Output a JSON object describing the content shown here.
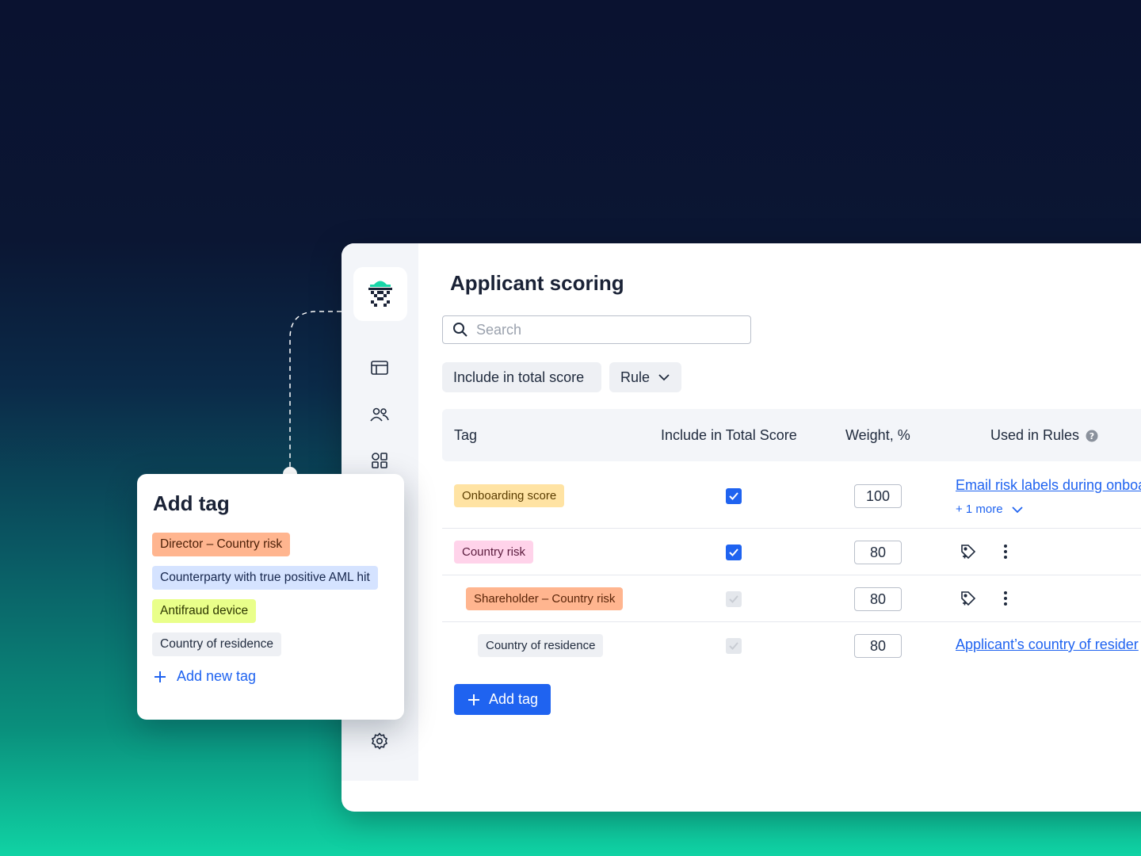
{
  "page": {
    "title": "Applicant scoring",
    "search_placeholder": "Search"
  },
  "filters": {
    "include_label": "Include in total score",
    "rule_label": "Rule"
  },
  "table": {
    "headers": [
      "Tag",
      "Include in Total Score",
      "Weight, %",
      "Used in Rules"
    ],
    "rows": [
      {
        "tag": "Onboarding score",
        "included": true,
        "weight": "100",
        "rule": "Email risk labels during onboa",
        "more": "+ 1 more"
      },
      {
        "tag": "Country risk",
        "included": true,
        "weight": "80"
      },
      {
        "tag": "Shareholder – Country risk",
        "included": false,
        "weight": "80"
      },
      {
        "tag": "Country of residence",
        "included": false,
        "weight": "80",
        "rule": "Applicant’s country of resider"
      }
    ]
  },
  "add_tag_button": "Add tag",
  "popup": {
    "title": "Add tag",
    "tags": [
      "Director – Country risk",
      "Counterparty with true positive AML hit",
      "Antifraud device",
      "Country of residence"
    ],
    "add_new_label": "Add new tag"
  },
  "sidebar": {
    "icons": [
      "logo-icon",
      "layout-icon",
      "users-icon",
      "apps-icon",
      "gear-icon"
    ]
  },
  "colors": {
    "accent": "#1f63f0",
    "tag_orange": "#ffb58f",
    "tag_yellow": "#ffe3a3",
    "tag_pink": "#ffd3ea",
    "tag_blue": "#d5e3ff",
    "tag_lime": "#e9ff8a",
    "tag_gray": "#eef0f4"
  }
}
